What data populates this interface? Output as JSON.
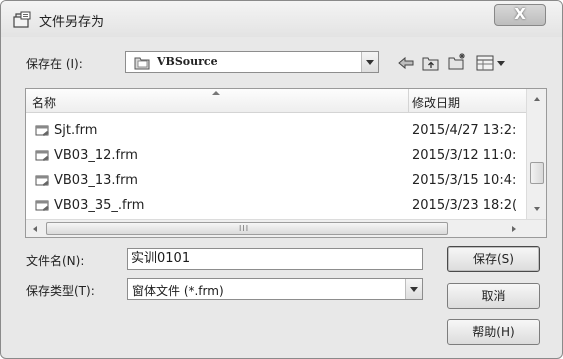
{
  "window": {
    "title": "文件另存为",
    "close_label": "X"
  },
  "toolbar": {
    "save_in_label": "保存在 (I):",
    "location_value": "VBSource",
    "icons": [
      "back-arrow-icon",
      "up-folder-icon",
      "new-folder-icon",
      "view-menu-icon"
    ]
  },
  "file_list": {
    "columns": [
      "名称",
      "修改日期"
    ],
    "rows": [
      {
        "name": "Sjt.frm",
        "date": "2015/4/27 13:2:"
      },
      {
        "name": "VB03_12.frm",
        "date": "2015/3/12 11:0:"
      },
      {
        "name": "VB03_13.frm",
        "date": "2015/3/15 10:4:"
      },
      {
        "name": "VB03_35_.frm",
        "date": "2015/3/23 18:2("
      }
    ],
    "scroll_grip": "III"
  },
  "form": {
    "filename_label": "文件名(N):",
    "filename_value": "实训0101",
    "filetype_label": "保存类型(T):",
    "filetype_value": "窗体文件 (*.frm)"
  },
  "buttons": {
    "save": "保存(S)",
    "cancel": "取消",
    "help": "帮助(H)"
  },
  "colors": {
    "dialog_bg": "#e8e8e8",
    "list_bg": "#ffffff",
    "border": "#8d8d8d"
  }
}
